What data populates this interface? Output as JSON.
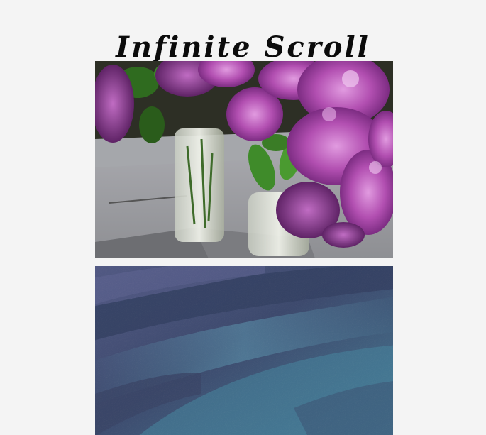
{
  "header": {
    "title": "Infinite Scroll"
  },
  "feed": {
    "items": [
      {
        "kind": "photo",
        "subject": "lilac-flowers-in-glass-vases"
      },
      {
        "kind": "photo",
        "subject": "blue-purple-textured-surface"
      }
    ]
  },
  "colors": {
    "page_background": "#f4f4f4",
    "title_text": "#0b0b0b",
    "lilac": "#b04fb3",
    "leaf": "#2f6b1f",
    "texture_blue": "#3e6f85",
    "texture_purple": "#3b3458"
  }
}
